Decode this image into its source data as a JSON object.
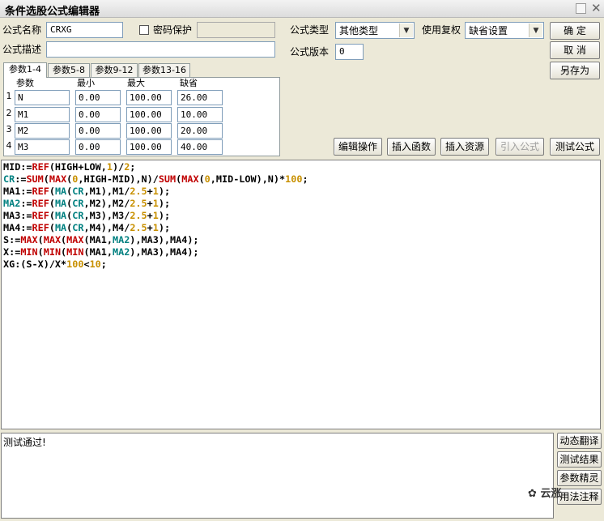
{
  "window": {
    "title": "条件选股公式编辑器"
  },
  "form": {
    "name_label": "公式名称",
    "name_value": "CRXG",
    "password_label": "密码保护",
    "desc_label": "公式描述",
    "desc_value": "",
    "type_label": "公式类型",
    "type_value": "其他类型",
    "rights_label": "使用复权",
    "rights_value": "缺省设置",
    "version_label": "公式版本",
    "version_value": "0"
  },
  "buttons": {
    "ok": "确  定",
    "cancel": "取  消",
    "save_as": "另存为",
    "edit_ops": "编辑操作",
    "insert_func": "插入函数",
    "insert_res": "插入资源",
    "import_formula": "引入公式",
    "test_formula": "测试公式"
  },
  "tabs": [
    "参数1-4",
    "参数5-8",
    "参数9-12",
    "参数13-16"
  ],
  "params": {
    "headers": [
      "参数",
      "最小",
      "最大",
      "缺省"
    ],
    "rows": [
      {
        "num": "1",
        "name": "N",
        "min": "0.00",
        "max": "100.00",
        "def": "26.00"
      },
      {
        "num": "2",
        "name": "M1",
        "min": "0.00",
        "max": "100.00",
        "def": "10.00"
      },
      {
        "num": "3",
        "name": "M2",
        "min": "0.00",
        "max": "100.00",
        "def": "20.00"
      },
      {
        "num": "4",
        "name": "M3",
        "min": "0.00",
        "max": "100.00",
        "def": "40.00"
      }
    ]
  },
  "code_lines": [
    [
      [
        "MID:=",
        ""
      ],
      [
        "REF",
        "fn"
      ],
      [
        "(HIGH+LOW,",
        ""
      ],
      [
        "1",
        "num"
      ],
      [
        ")/",
        ""
      ],
      [
        "2",
        "num"
      ],
      [
        ";",
        ""
      ]
    ],
    [
      [
        "CR",
        "var2"
      ],
      [
        ":=",
        ""
      ],
      [
        "SUM",
        "fn"
      ],
      [
        "(",
        ""
      ],
      [
        "MAX",
        "fn"
      ],
      [
        "(",
        ""
      ],
      [
        "0",
        "num"
      ],
      [
        ",HIGH-MID),N)/",
        ""
      ],
      [
        "SUM",
        "fn"
      ],
      [
        "(",
        ""
      ],
      [
        "MAX",
        "fn"
      ],
      [
        "(",
        ""
      ],
      [
        "0",
        "num"
      ],
      [
        ",MID-LOW),N)*",
        ""
      ],
      [
        "100",
        "num"
      ],
      [
        ";",
        ""
      ]
    ],
    [
      [
        "MA1:=",
        ""
      ],
      [
        "REF",
        "fn"
      ],
      [
        "(",
        ""
      ],
      [
        "MA",
        "fn2"
      ],
      [
        "(",
        ""
      ],
      [
        "CR",
        "var2"
      ],
      [
        ",M1),M1/",
        ""
      ],
      [
        "2.5",
        "num"
      ],
      [
        "+",
        ""
      ],
      [
        "1",
        "num"
      ],
      [
        ");",
        ""
      ]
    ],
    [
      [
        "MA2",
        "var2"
      ],
      [
        ":=",
        ""
      ],
      [
        "REF",
        "fn"
      ],
      [
        "(",
        ""
      ],
      [
        "MA",
        "fn2"
      ],
      [
        "(",
        ""
      ],
      [
        "CR",
        "var2"
      ],
      [
        ",M2),M2/",
        ""
      ],
      [
        "2.5",
        "num"
      ],
      [
        "+",
        ""
      ],
      [
        "1",
        "num"
      ],
      [
        ");",
        ""
      ]
    ],
    [
      [
        "MA3:=",
        ""
      ],
      [
        "REF",
        "fn"
      ],
      [
        "(",
        ""
      ],
      [
        "MA",
        "fn2"
      ],
      [
        "(",
        ""
      ],
      [
        "CR",
        "var2"
      ],
      [
        ",M3),M3/",
        ""
      ],
      [
        "2.5",
        "num"
      ],
      [
        "+",
        ""
      ],
      [
        "1",
        "num"
      ],
      [
        ");",
        ""
      ]
    ],
    [
      [
        "MA4:=",
        ""
      ],
      [
        "REF",
        "fn"
      ],
      [
        "(",
        ""
      ],
      [
        "MA",
        "fn2"
      ],
      [
        "(",
        ""
      ],
      [
        "CR",
        "var2"
      ],
      [
        ",M4),M4/",
        ""
      ],
      [
        "2.5",
        "num"
      ],
      [
        "+",
        ""
      ],
      [
        "1",
        "num"
      ],
      [
        ");",
        ""
      ]
    ],
    [
      [
        "S:=",
        ""
      ],
      [
        "MAX",
        "fn"
      ],
      [
        "(",
        ""
      ],
      [
        "MAX",
        "fn"
      ],
      [
        "(",
        ""
      ],
      [
        "MAX",
        "fn"
      ],
      [
        "(MA1,",
        ""
      ],
      [
        "MA2",
        "var2"
      ],
      [
        "),MA3),MA4);",
        ""
      ]
    ],
    [
      [
        "X:=",
        ""
      ],
      [
        "MIN",
        "fn"
      ],
      [
        "(",
        ""
      ],
      [
        "MIN",
        "fn"
      ],
      [
        "(",
        ""
      ],
      [
        "MIN",
        "fn"
      ],
      [
        "(MA1,",
        ""
      ],
      [
        "MA2",
        "var2"
      ],
      [
        "),MA3),MA4);",
        ""
      ]
    ],
    [
      [
        "XG:(S-X)/X*",
        ""
      ],
      [
        "100",
        "num"
      ],
      [
        "<",
        ""
      ],
      [
        "10",
        "num"
      ],
      [
        ";",
        ""
      ]
    ]
  ],
  "status": {
    "message": "测试通过!"
  },
  "side_buttons": [
    "动态翻译",
    "测试结果",
    "参数精灵",
    "用法注释"
  ],
  "watermark": "云涨"
}
